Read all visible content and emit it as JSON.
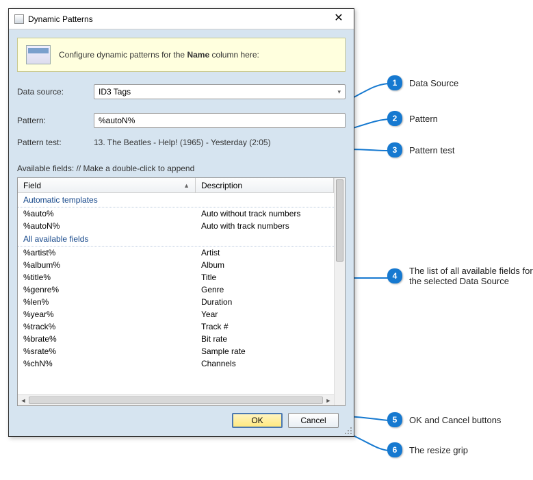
{
  "window": {
    "title": "Dynamic Patterns",
    "close_glyph": "✕"
  },
  "info": {
    "text_prefix": "Configure dynamic patterns for the ",
    "text_bold": "Name",
    "text_suffix": " column here:"
  },
  "labels": {
    "data_source": "Data source:",
    "pattern": "Pattern:",
    "pattern_test": "Pattern test:",
    "available_fields": "Available fields: // Make a double-click to append"
  },
  "values": {
    "data_source_selected": "ID3 Tags",
    "pattern_value": "%autoN%",
    "pattern_test_value": "13. The Beatles - Help! (1965) - Yesterday (2:05)"
  },
  "grid": {
    "col_field": "Field",
    "col_desc": "Description",
    "sort_glyph": "▲",
    "groups": [
      {
        "title": "Automatic templates",
        "rows": [
          {
            "field": "%auto%",
            "desc": "Auto without track numbers"
          },
          {
            "field": "%autoN%",
            "desc": "Auto with track numbers"
          }
        ]
      },
      {
        "title": "All available fields",
        "rows": [
          {
            "field": "%artist%",
            "desc": "Artist"
          },
          {
            "field": "%album%",
            "desc": "Album"
          },
          {
            "field": "%title%",
            "desc": "Title"
          },
          {
            "field": "%genre%",
            "desc": "Genre"
          },
          {
            "field": "%len%",
            "desc": "Duration"
          },
          {
            "field": "%year%",
            "desc": "Year"
          },
          {
            "field": "%track%",
            "desc": "Track #"
          },
          {
            "field": "%brate%",
            "desc": "Bit rate"
          },
          {
            "field": "%srate%",
            "desc": "Sample rate"
          },
          {
            "field": "%chN%",
            "desc": "Channels"
          }
        ]
      }
    ]
  },
  "buttons": {
    "ok": "OK",
    "cancel": "Cancel"
  },
  "callouts": [
    {
      "n": "1",
      "text": "Data Source"
    },
    {
      "n": "2",
      "text": "Pattern"
    },
    {
      "n": "3",
      "text": "Pattern test"
    },
    {
      "n": "4",
      "text": "The list of all available fields for the selected Data Source"
    },
    {
      "n": "5",
      "text": "OK and Cancel buttons"
    },
    {
      "n": "6",
      "text": "The resize grip"
    }
  ]
}
